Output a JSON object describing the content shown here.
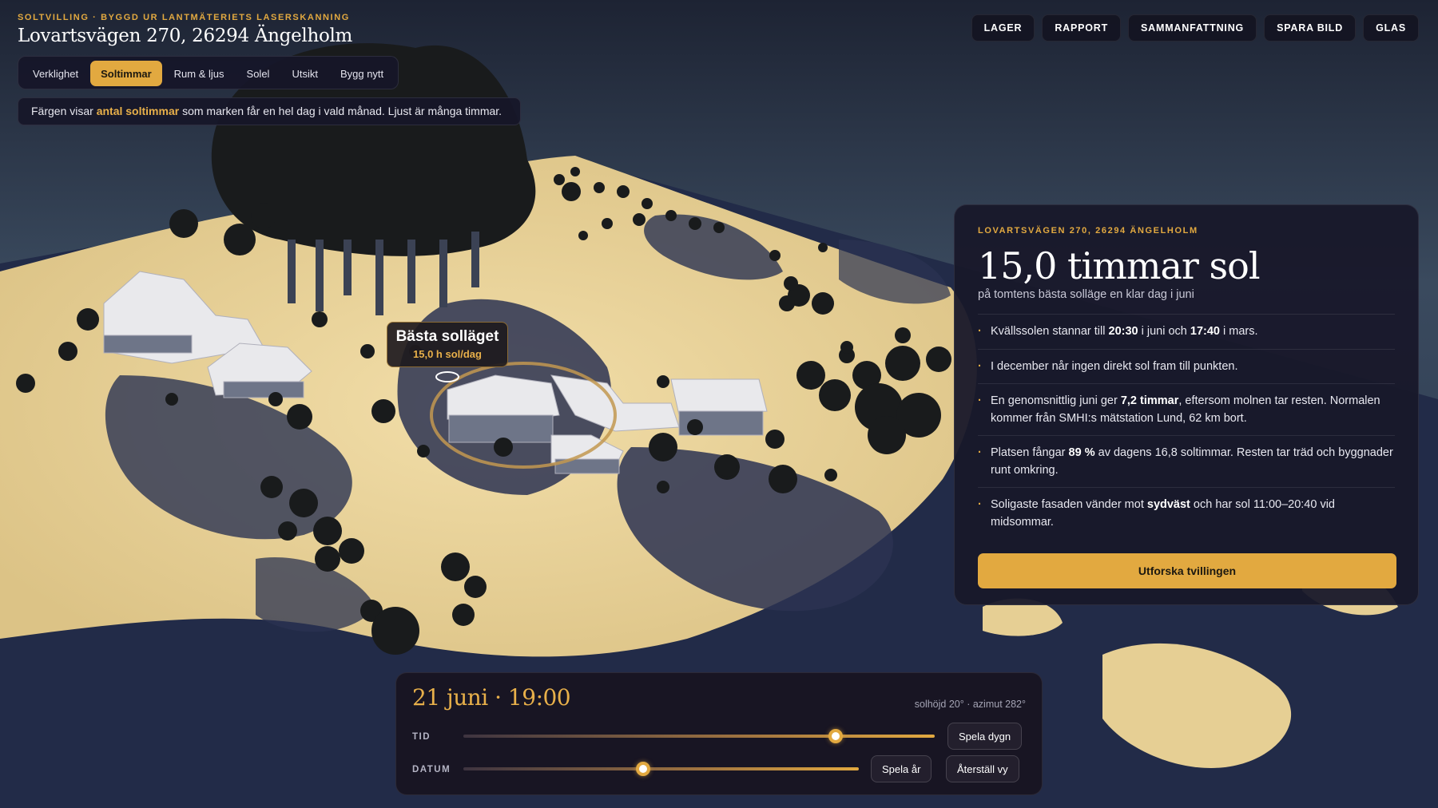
{
  "header": {
    "eyebrow": "SOLTVILLING · BYGGD UR LANTMÄTERIETS LASERSKANNING",
    "title": "Lovartsvägen 270, 26294 Ängelholm"
  },
  "tabs": [
    {
      "label": "Verklighet",
      "active": false
    },
    {
      "label": "Soltimmar",
      "active": true
    },
    {
      "label": "Rum & ljus",
      "active": false
    },
    {
      "label": "Solel",
      "active": false
    },
    {
      "label": "Utsikt",
      "active": false
    },
    {
      "label": "Bygg nytt",
      "active": false
    }
  ],
  "hint": {
    "pre": "Färgen visar ",
    "accent": "antal soltimmar",
    "post": " som marken får en hel dag i vald månad. Ljust är många timmar."
  },
  "top_actions": [
    "LAGER",
    "RAPPORT",
    "SAMMANFATTNING",
    "SPARA BILD",
    "GLAS"
  ],
  "spot_label": {
    "title": "Bästa solläget",
    "value": "15,0 h sol/dag"
  },
  "panel": {
    "eyebrow": "LOVARTSVÄGEN 270, 26294 ÄNGELHOLM",
    "headline": "15,0 timmar sol",
    "sub": "på tomtens bästa solläge en klar dag i juni",
    "facts": [
      {
        "parts": [
          {
            "t": "Kvällssolen stannar till "
          },
          {
            "t": "20:30",
            "b": true
          },
          {
            "t": " i juni och "
          },
          {
            "t": "17:40",
            "b": true
          },
          {
            "t": " i mars."
          }
        ]
      },
      {
        "parts": [
          {
            "t": "I december når ingen direkt sol fram till punkten."
          }
        ]
      },
      {
        "parts": [
          {
            "t": "En genomsnittlig juni ger "
          },
          {
            "t": "7,2 timmar",
            "b": true
          },
          {
            "t": ", eftersom molnen tar resten. Normalen kommer från SMHI:s mätstation Lund, 62 km bort."
          }
        ]
      },
      {
        "parts": [
          {
            "t": "Platsen fångar "
          },
          {
            "t": "89 %",
            "b": true
          },
          {
            "t": " av dagens 16,8 soltimmar. Resten tar träd och byggnader runt omkring."
          }
        ]
      },
      {
        "parts": [
          {
            "t": "Soligaste fasaden vänder mot "
          },
          {
            "t": "sydväst",
            "b": true
          },
          {
            "t": " och har sol 11:00–20:40 vid midsommar."
          }
        ]
      }
    ],
    "cta": "Utforska tvillingen"
  },
  "time_control": {
    "title": "21 juni · 19:00",
    "sun_position": "solhöjd 20° · azimut 282°",
    "tid_label": "TID",
    "datum_label": "DATUM",
    "tid_fraction": 0.79,
    "datum_fraction": 0.455,
    "play_day": "Spela dygn",
    "play_year": "Spela år",
    "reset_view": "Återställ vy"
  },
  "colors": {
    "accent": "#e2a940",
    "panel_bg": "#18182a",
    "ground_sun": "#eed7a0",
    "ground_shade": "#27304f",
    "tree": "#191b1c",
    "house_roof": "#e9e9ec"
  }
}
